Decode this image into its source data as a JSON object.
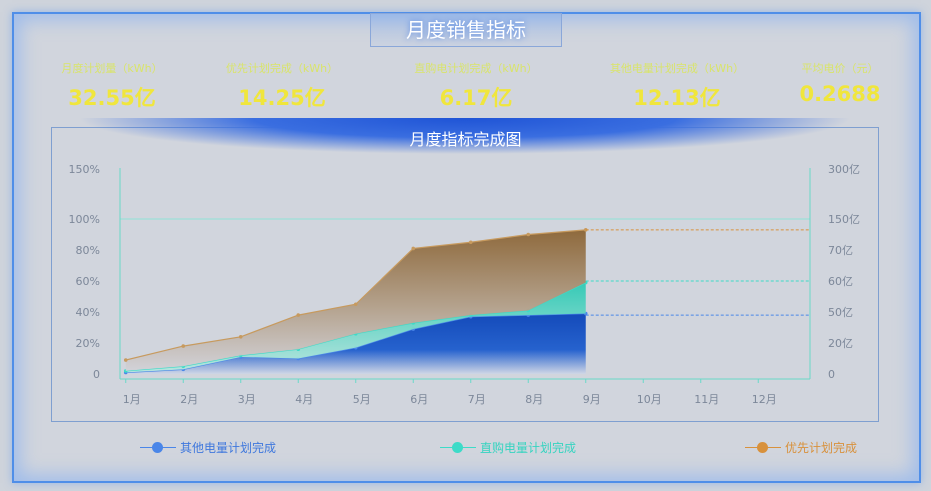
{
  "header": {
    "title": "月度销售指标"
  },
  "kpis": [
    {
      "label": "月度计划量（kWh）",
      "value": "32.55亿"
    },
    {
      "label": "优先计划完成（kWh）",
      "value": "14.25亿"
    },
    {
      "label": "直购电计划完成（kWh）",
      "value": "6.17亿"
    },
    {
      "label": "其他电量计划完成（kWh）",
      "value": "12.13亿"
    },
    {
      "label": "平均电价（元）",
      "value": "0.2688"
    }
  ],
  "legend": [
    {
      "label": "其他电量计划完成",
      "color": "#4a86e8"
    },
    {
      "label": "直购电量计划完成",
      "color": "#3ddbc8"
    },
    {
      "label": "优先计划完成",
      "color": "#d8913c"
    }
  ],
  "chart_data": {
    "type": "area",
    "title": "月度指标完成图",
    "stacked": true,
    "categories": [
      "1月",
      "2月",
      "3月",
      "4月",
      "5月",
      "6月",
      "7月",
      "8月",
      "9月",
      "10月",
      "11月",
      "12月"
    ],
    "y_left_ticks": [
      "0",
      "20%",
      "40%",
      "60%",
      "80%",
      "100%",
      "150%"
    ],
    "y_right_ticks": [
      "0",
      "20亿",
      "50亿",
      "60亿",
      "70亿",
      "150亿",
      "300亿"
    ],
    "series": [
      {
        "name": "其他电量计划完成",
        "color": "#0a43b8",
        "values": [
          1,
          3,
          11,
          10,
          17,
          29,
          37,
          38,
          39,
          null,
          null,
          null
        ]
      },
      {
        "name": "直购电量计划完成",
        "color": "#3ddbc8",
        "values": [
          1,
          2,
          1,
          6,
          9,
          4,
          1,
          3,
          20,
          null,
          null,
          null
        ]
      },
      {
        "name": "优先计划完成",
        "color": "#9a7342",
        "values": [
          7,
          13,
          12,
          22,
          19,
          48,
          47,
          49,
          34,
          null,
          null,
          null
        ]
      }
    ],
    "reference_lines": [
      {
        "level": 93,
        "color": "#d8913c"
      },
      {
        "level": 60,
        "color": "#3ddbc8"
      },
      {
        "level": 38,
        "color": "#4a86e8"
      }
    ],
    "grid": true,
    "legend_position": "bottom"
  }
}
